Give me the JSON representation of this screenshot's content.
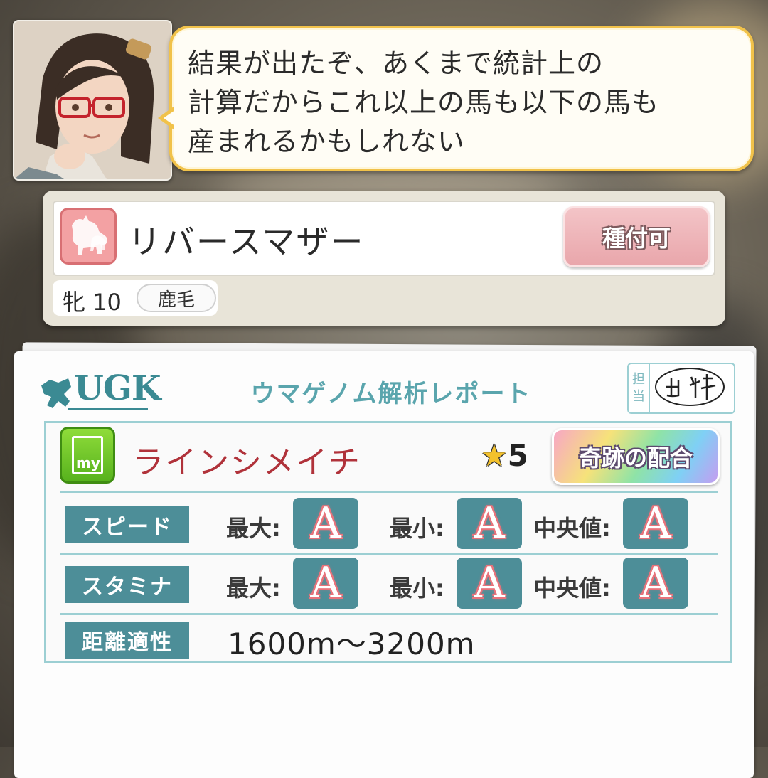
{
  "dialogue": {
    "lines": [
      "結果が出たぞ、あくまで統計上の",
      "計算だからこれ以上の馬も以下の馬も",
      "産まれるかもしれない"
    ]
  },
  "horse": {
    "name": "リバースマザー",
    "status_button": "種付可",
    "sex_age": "牝 10",
    "coat": "鹿毛"
  },
  "report": {
    "logo_text": "UGK",
    "title": "ウマゲノム解析レポート",
    "stamp_label": [
      "担",
      "当"
    ],
    "my_icon_text": "my",
    "partner_name": "ラインシメイチ",
    "star_symbol": "★",
    "star_count": "5",
    "badge": "奇跡の配合",
    "stats": [
      {
        "label": "スピード",
        "max_label": "最大:",
        "max": "A",
        "min_label": "最小:",
        "min": "A",
        "median_label": "中央値:",
        "median": "A"
      },
      {
        "label": "スタミナ",
        "max_label": "最大:",
        "max": "A",
        "min_label": "最小:",
        "min": "A",
        "median_label": "中央値:",
        "median": "A"
      }
    ],
    "distance": {
      "label": "距離適性",
      "value": "1600m〜3200m"
    }
  },
  "colors": {
    "bubble_border": "#f1c24a",
    "teal": "#4d8e98",
    "partner_red": "#b0323a",
    "grade_glow": "#e8737b"
  }
}
